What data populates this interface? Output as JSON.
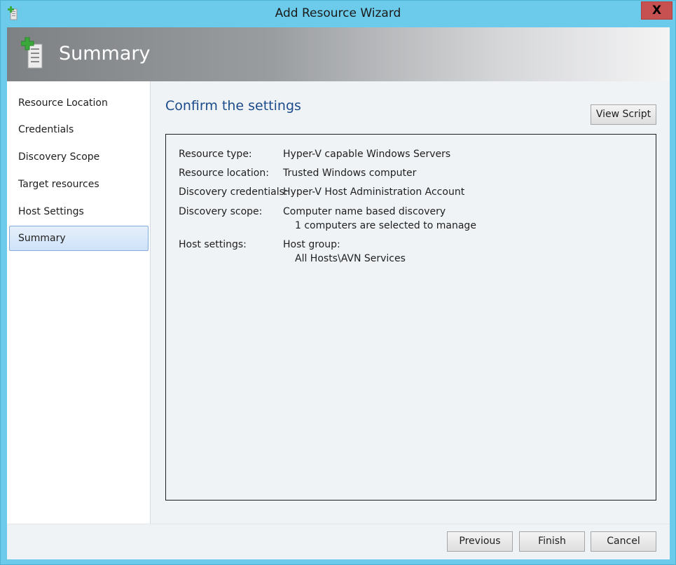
{
  "window": {
    "title": "Add Resource Wizard",
    "close_label": "X"
  },
  "header": {
    "title": "Summary",
    "icon": "server-add-icon"
  },
  "sidebar": {
    "items": [
      {
        "label": "Resource Location",
        "selected": false
      },
      {
        "label": "Credentials",
        "selected": false
      },
      {
        "label": "Discovery Scope",
        "selected": false
      },
      {
        "label": "Target resources",
        "selected": false
      },
      {
        "label": "Host Settings",
        "selected": false
      },
      {
        "label": "Summary",
        "selected": true
      }
    ]
  },
  "main": {
    "heading": "Confirm the settings",
    "view_script_label": "View Script",
    "settings": [
      {
        "label": "Resource type:",
        "value": "Hyper-V capable Windows Servers",
        "detail": ""
      },
      {
        "label": "Resource location:",
        "value": "Trusted Windows computer",
        "detail": ""
      },
      {
        "label": "Discovery credentials:",
        "value": "Hyper-V Host Administration Account",
        "detail": ""
      },
      {
        "label": "Discovery scope:",
        "value": "Computer name based discovery",
        "detail": "1 computers are selected to manage"
      },
      {
        "label": "Host settings:",
        "value": "Host group:",
        "detail": "All Hosts\\AVN Services"
      }
    ]
  },
  "footer": {
    "previous_label": "Previous",
    "finish_label": "Finish",
    "cancel_label": "Cancel"
  },
  "colors": {
    "frame": "#6ccbea",
    "heading": "#1b4b8a",
    "close": "#c75050",
    "selected_nav": "#cfe2f9"
  }
}
